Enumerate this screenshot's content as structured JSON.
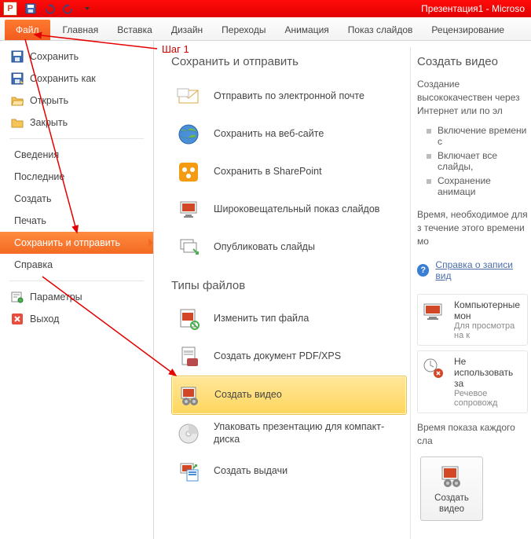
{
  "titlebar": {
    "app_letter": "P",
    "title": "Презентация1 - Microso"
  },
  "ribbon": {
    "file": "Файл",
    "tabs": [
      "Главная",
      "Вставка",
      "Дизайн",
      "Переходы",
      "Анимация",
      "Показ слайдов",
      "Рецензирование"
    ]
  },
  "annotation": {
    "step1": "Шаг 1"
  },
  "sidebar": {
    "items": [
      {
        "label": "Сохранить",
        "icon": "save"
      },
      {
        "label": "Сохранить как",
        "icon": "saveas"
      },
      {
        "label": "Открыть",
        "icon": "open"
      },
      {
        "label": "Закрыть",
        "icon": "close"
      }
    ],
    "items2": [
      {
        "label": "Сведения"
      },
      {
        "label": "Последние"
      },
      {
        "label": "Создать"
      },
      {
        "label": "Печать"
      },
      {
        "label": "Сохранить и отправить",
        "selected": true
      },
      {
        "label": "Справка"
      }
    ],
    "items3": [
      {
        "label": "Параметры",
        "icon": "options"
      },
      {
        "label": "Выход",
        "icon": "exit"
      }
    ]
  },
  "content": {
    "section_send": "Сохранить и отправить",
    "send_actions": [
      {
        "label": "Отправить по электронной почте",
        "icon": "mail"
      },
      {
        "label": "Сохранить на веб-сайте",
        "icon": "globe"
      },
      {
        "label": "Сохранить в SharePoint",
        "icon": "sharepoint"
      },
      {
        "label": "Широковещательный показ слайдов",
        "icon": "broadcast"
      },
      {
        "label": "Опубликовать слайды",
        "icon": "publish"
      }
    ],
    "section_types": "Типы файлов",
    "type_actions": [
      {
        "label": "Изменить тип файла",
        "icon": "changetype"
      },
      {
        "label": "Создать документ PDF/XPS",
        "icon": "pdf"
      },
      {
        "label": "Создать видео",
        "icon": "video",
        "selected": true
      },
      {
        "label": "Упаковать презентацию для компакт-диска",
        "icon": "cd"
      },
      {
        "label": "Создать выдачи",
        "icon": "handouts"
      }
    ]
  },
  "right": {
    "heading": "Создать видео",
    "desc": "Создание высококачествен через Интернет или по эл",
    "bullets": [
      "Включение времени с",
      "Включает все слайды,",
      "Сохранение анимаци"
    ],
    "time_desc": "Время, необходимое для з течение этого времени мо",
    "help_label": "Справка о записи вид",
    "option1": {
      "title": "Компьютерные мон",
      "sub": "Для просмотра на к"
    },
    "option2": {
      "title": "Не использовать за",
      "sub": "Речевое сопровожд"
    },
    "time_label": "Время показа каждого сла",
    "button": "Создать\nвидео"
  }
}
